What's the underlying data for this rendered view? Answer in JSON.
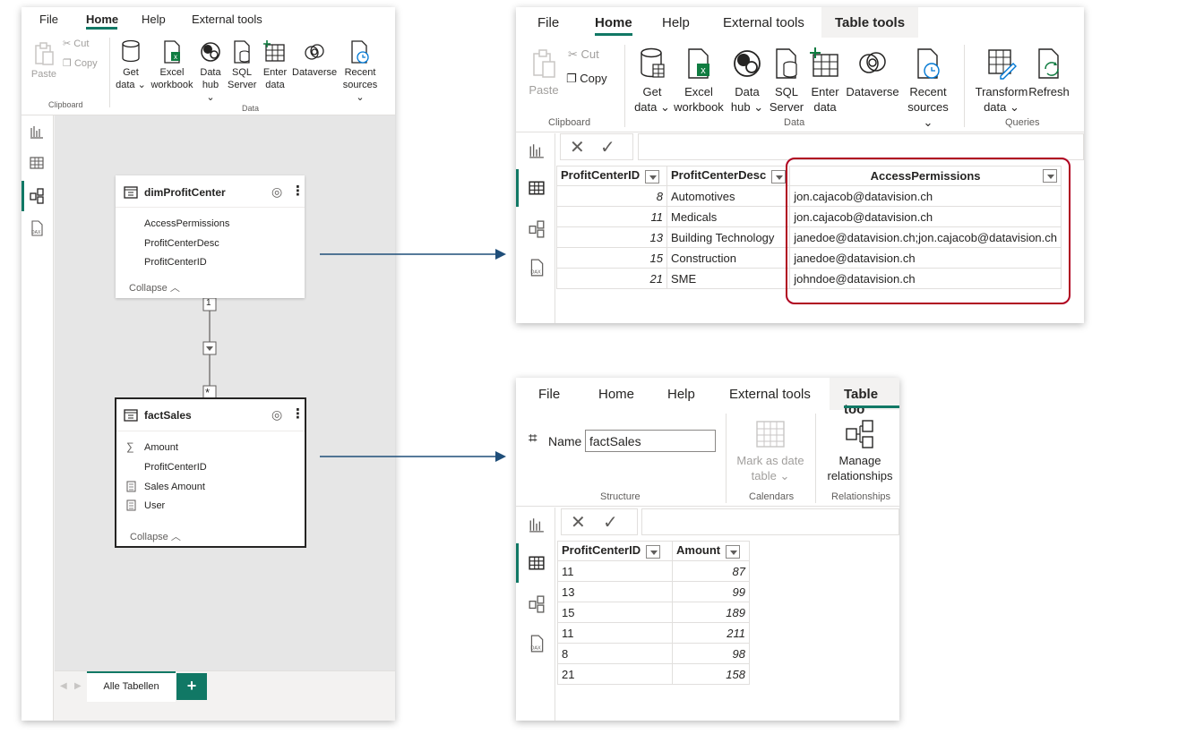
{
  "left_panel": {
    "menu": [
      "File",
      "Home",
      "Help",
      "External tools"
    ],
    "ribbon": {
      "clipboard": {
        "paste": "Paste",
        "cut": "Cut",
        "copy": "Copy",
        "group": "Clipboard"
      },
      "data": {
        "get_data": [
          "Get",
          "data"
        ],
        "excel": [
          "Excel",
          "workbook"
        ],
        "data_hub": [
          "Data",
          "hub"
        ],
        "sql": [
          "SQL",
          "Server"
        ],
        "enter": [
          "Enter",
          "data"
        ],
        "dataverse": "Dataverse",
        "recent": [
          "Recent",
          "sources"
        ],
        "group": "Data"
      }
    },
    "tables": [
      {
        "name": "dimProfitCenter",
        "columns": [
          "AccessPermissions",
          "ProfitCenterDesc",
          "ProfitCenterID"
        ],
        "collapse": "Collapse"
      },
      {
        "name": "factSales",
        "columns": [
          "Amount",
          "ProfitCenterID",
          "Sales Amount",
          "User"
        ],
        "collapse": "Collapse"
      }
    ],
    "relationship": {
      "one": "1",
      "many": "*"
    },
    "tab": "Alle Tabellen",
    "add_tab": "+"
  },
  "top_right": {
    "menu": [
      "File",
      "Home",
      "Help",
      "External tools",
      "Table tools"
    ],
    "ribbon": {
      "paste": "Paste",
      "cut": "Cut",
      "copy": "Copy",
      "clipboard_group": "Clipboard",
      "get_data": [
        "Get",
        "data"
      ],
      "excel": [
        "Excel",
        "workbook"
      ],
      "data_hub": [
        "Data",
        "hub"
      ],
      "sql": [
        "SQL",
        "Server"
      ],
      "enter": [
        "Enter",
        "data"
      ],
      "dataverse": "Dataverse",
      "recent": [
        "Recent",
        "sources"
      ],
      "data_group": "Data",
      "transform": [
        "Transform",
        "data"
      ],
      "refresh": "Refresh",
      "queries_group": "Queries"
    },
    "grid": {
      "headers": [
        "ProfitCenterID",
        "ProfitCenterDesc",
        "AccessPermissions"
      ],
      "rows": [
        [
          "8",
          "Automotives",
          "jon.cajacob@datavision.ch"
        ],
        [
          "11",
          "Medicals",
          "jon.cajacob@datavision.ch"
        ],
        [
          "13",
          "Building Technology",
          "janedoe@datavision.ch;jon.cajacob@datavision.ch"
        ],
        [
          "15",
          "Construction",
          "janedoe@datavision.ch"
        ],
        [
          "21",
          "SME",
          "johndoe@datavision.ch"
        ]
      ]
    },
    "highlight_color": "#b00020"
  },
  "bottom_right": {
    "menu": [
      "File",
      "Home",
      "Help",
      "External tools",
      "Table too"
    ],
    "ribbon": {
      "name_label": "Name",
      "name_value": "factSales",
      "structure_group": "Structure",
      "mark_date": [
        "Mark as date",
        "table"
      ],
      "calendars_group": "Calendars",
      "manage_rel": [
        "Manage",
        "relationships"
      ],
      "relationships_group": "Relationships"
    },
    "grid": {
      "headers": [
        "ProfitCenterID",
        "Amount"
      ],
      "rows": [
        [
          "11",
          "87"
        ],
        [
          "13",
          "99"
        ],
        [
          "15",
          "189"
        ],
        [
          "11",
          "211"
        ],
        [
          "8",
          "98"
        ],
        [
          "21",
          "158"
        ]
      ]
    }
  },
  "colors": {
    "accent": "#117865",
    "arrow": "#1f4e79"
  }
}
